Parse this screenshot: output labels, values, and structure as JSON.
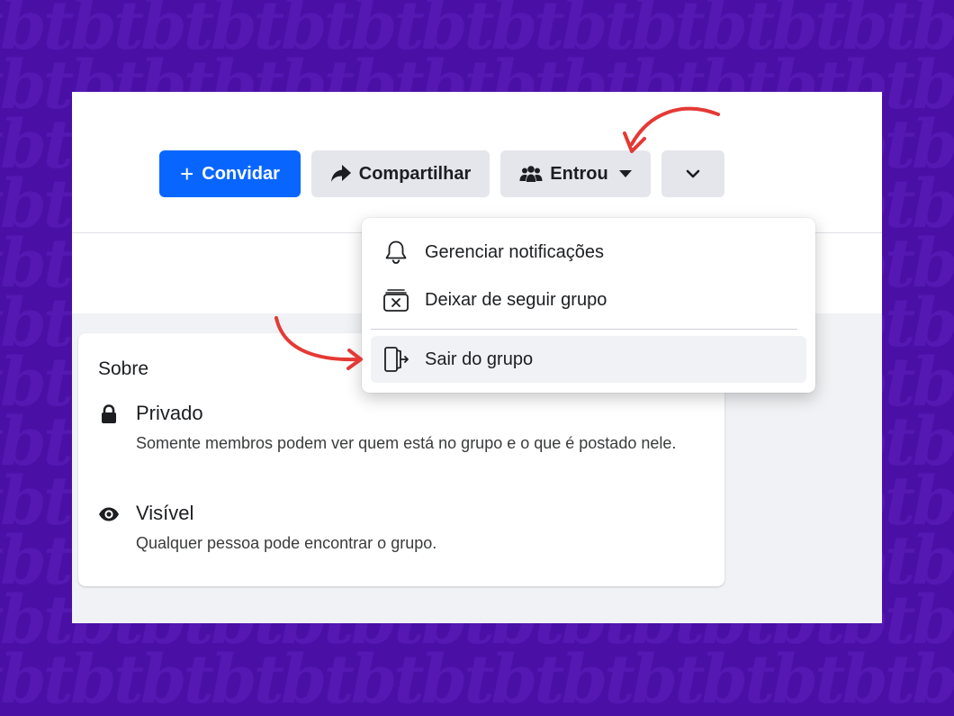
{
  "watermark": {
    "text": "tbtbtbtbtbtbtbtbtbtbtbtbtbtbtbtbtb"
  },
  "toolbar": {
    "invite_label": "Convidar",
    "share_label": "Compartilhar",
    "joined_label": "Entrou"
  },
  "dropdown": {
    "items": [
      {
        "label": "Gerenciar notificações",
        "icon": "bell-icon"
      },
      {
        "label": "Deixar de seguir grupo",
        "icon": "unfollow-icon"
      },
      {
        "label": "Sair do grupo",
        "icon": "leave-door-icon"
      }
    ]
  },
  "about": {
    "title": "Sobre",
    "privacy": {
      "name": "Privado",
      "description": "Somente membros podem ver quem está no grupo e o que é postado nele.",
      "icon": "lock-icon"
    },
    "visibility": {
      "name": "Visível",
      "description": "Qualquer pessoa pode encontrar o grupo.",
      "icon": "eye-icon"
    }
  },
  "colors": {
    "background": "#4a10a6",
    "primary": "#0866ff",
    "annotation_arrow": "#e53935"
  }
}
